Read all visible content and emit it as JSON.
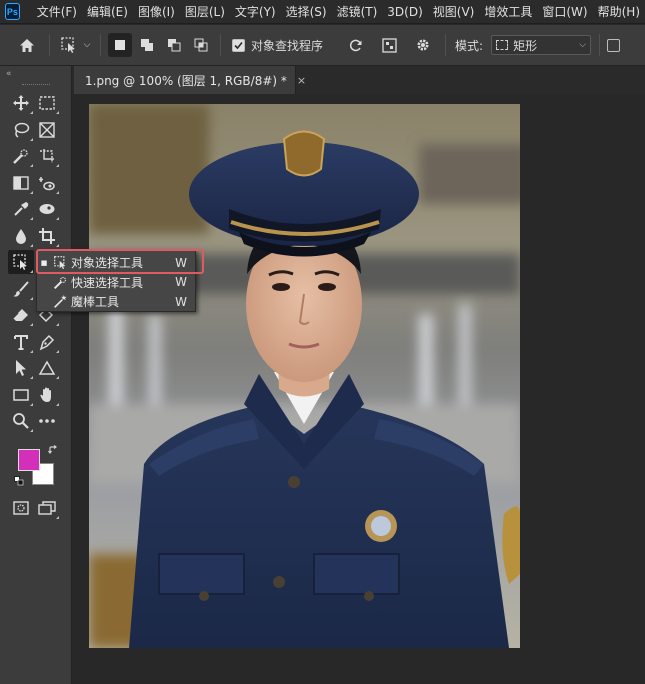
{
  "app": {
    "logo": "Ps"
  },
  "menu": [
    "文件(F)",
    "编辑(E)",
    "图像(I)",
    "图层(L)",
    "文字(Y)",
    "选择(S)",
    "滤镜(T)",
    "3D(D)",
    "视图(V)",
    "增效工具",
    "窗口(W)",
    "帮助(H)"
  ],
  "options": {
    "object_finder_label": "对象查找程序",
    "object_finder_checked": true,
    "mode_label": "模式:",
    "mode_value": "矩形"
  },
  "toolbar": {
    "collapse_glyph": "«",
    "foreground_color": "#d42fb8",
    "background_color": "#ffffff"
  },
  "document": {
    "tab_title": "1.png @ 100% (图层 1, RGB/8#) *",
    "close_glyph": "×"
  },
  "flyout": {
    "items": [
      {
        "label": "对象选择工具",
        "shortcut": "W",
        "selected": true,
        "icon": "object-select-icon"
      },
      {
        "label": "快速选择工具",
        "shortcut": "W",
        "selected": false,
        "icon": "quick-select-icon"
      },
      {
        "label": "魔棒工具",
        "shortcut": "W",
        "selected": false,
        "icon": "magic-wand-icon"
      }
    ]
  },
  "colors": {
    "accent_highlight": "#e05a62",
    "ps_blue": "#31a8ff"
  }
}
